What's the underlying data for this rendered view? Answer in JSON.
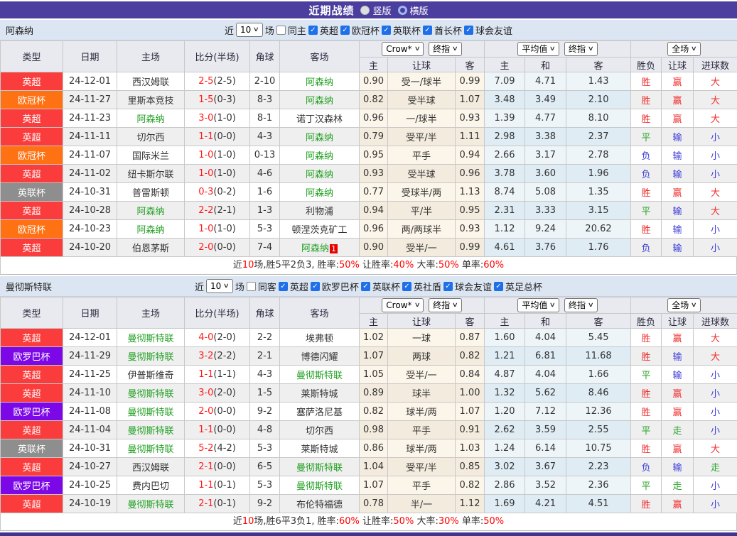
{
  "title_bar": {
    "title": "近期战绩",
    "radios": [
      {
        "label": "竖版",
        "selected": false
      },
      {
        "label": "横版",
        "selected": true
      }
    ]
  },
  "colors": {
    "league": {
      "英超": "#fb3c3c",
      "欧冠杯": "#ff7214",
      "英联杯": "#8e8e8e",
      "欧罗巴杯": "#7c08e8"
    },
    "outcome": {
      "胜": "#f03030",
      "赢": "#f03030",
      "大": "#f03030",
      "平": "#2ca52c",
      "走": "#2ca52c",
      "负": "#3b3bd8",
      "输": "#3b3bd8",
      "小": "#3b3bd8"
    },
    "focus_team": "#22a022",
    "score": "#ff1a1a",
    "half_score": "#333333"
  },
  "sections": [
    {
      "team": "阿森纳",
      "filter": {
        "near_label": "近",
        "matches": "10",
        "matches_suffix": "场",
        "same_label": "同主",
        "same_checked": false,
        "leagues": [
          {
            "label": "英超",
            "checked": true
          },
          {
            "label": "欧冠杯",
            "checked": true
          },
          {
            "label": "英联杯",
            "checked": true
          },
          {
            "label": "酋长杯",
            "checked": true
          },
          {
            "label": "球会友谊",
            "checked": true
          }
        ]
      },
      "header": {
        "columns": [
          "类型",
          "日期",
          "主场",
          "比分(半场)",
          "角球",
          "客场"
        ],
        "dropdowns": {
          "handicap": [
            "Crow*",
            "终指"
          ],
          "average": [
            "平均值",
            "终指"
          ],
          "result": [
            "全场"
          ]
        },
        "sub": [
          "主",
          "让球",
          "客",
          "主",
          "和",
          "客",
          "胜负",
          "让球",
          "进球数"
        ]
      },
      "rows": [
        {
          "league": "英超",
          "date": "24-12-01",
          "home": "西汉姆联",
          "homeFocus": false,
          "score": "2-5",
          "half": "(2-5)",
          "corner": "2-10",
          "away": "阿森纳",
          "awayFocus": true,
          "note": "",
          "oh": "0.90",
          "line": "受一/球半",
          "oa": "0.99",
          "ah": "7.09",
          "ad": "4.71",
          "aa": "1.43",
          "r1": "胜",
          "r2": "赢",
          "r3": "大"
        },
        {
          "league": "欧冠杯",
          "date": "24-11-27",
          "home": "里斯本竞技",
          "homeFocus": false,
          "score": "1-5",
          "half": "(0-3)",
          "corner": "8-3",
          "away": "阿森纳",
          "awayFocus": true,
          "note": "",
          "oh": "0.82",
          "line": "受半球",
          "oa": "1.07",
          "ah": "3.48",
          "ad": "3.49",
          "aa": "2.10",
          "r1": "胜",
          "r2": "赢",
          "r3": "大"
        },
        {
          "league": "英超",
          "date": "24-11-23",
          "home": "阿森纳",
          "homeFocus": true,
          "score": "3-0",
          "half": "(1-0)",
          "corner": "8-1",
          "away": "诺丁汉森林",
          "awayFocus": false,
          "note": "",
          "oh": "0.96",
          "line": "一/球半",
          "oa": "0.93",
          "ah": "1.39",
          "ad": "4.77",
          "aa": "8.10",
          "r1": "胜",
          "r2": "赢",
          "r3": "大"
        },
        {
          "league": "英超",
          "date": "24-11-11",
          "home": "切尔西",
          "homeFocus": false,
          "score": "1-1",
          "half": "(0-0)",
          "corner": "4-3",
          "away": "阿森纳",
          "awayFocus": true,
          "note": "",
          "oh": "0.79",
          "line": "受平/半",
          "oa": "1.11",
          "ah": "2.98",
          "ad": "3.38",
          "aa": "2.37",
          "r1": "平",
          "r2": "输",
          "r3": "小"
        },
        {
          "league": "欧冠杯",
          "date": "24-11-07",
          "home": "国际米兰",
          "homeFocus": false,
          "score": "1-0",
          "half": "(1-0)",
          "corner": "0-13",
          "away": "阿森纳",
          "awayFocus": true,
          "note": "",
          "oh": "0.95",
          "line": "平手",
          "oa": "0.94",
          "ah": "2.66",
          "ad": "3.17",
          "aa": "2.78",
          "r1": "负",
          "r2": "输",
          "r3": "小"
        },
        {
          "league": "英超",
          "date": "24-11-02",
          "home": "纽卡斯尔联",
          "homeFocus": false,
          "score": "1-0",
          "half": "(1-0)",
          "corner": "4-6",
          "away": "阿森纳",
          "awayFocus": true,
          "note": "",
          "oh": "0.93",
          "line": "受半球",
          "oa": "0.96",
          "ah": "3.78",
          "ad": "3.60",
          "aa": "1.96",
          "r1": "负",
          "r2": "输",
          "r3": "小"
        },
        {
          "league": "英联杯",
          "date": "24-10-31",
          "home": "普雷斯顿",
          "homeFocus": false,
          "score": "0-3",
          "half": "(0-2)",
          "corner": "1-6",
          "away": "阿森纳",
          "awayFocus": true,
          "note": "",
          "oh": "0.77",
          "line": "受球半/两",
          "oa": "1.13",
          "ah": "8.74",
          "ad": "5.08",
          "aa": "1.35",
          "r1": "胜",
          "r2": "赢",
          "r3": "大"
        },
        {
          "league": "英超",
          "date": "24-10-28",
          "home": "阿森纳",
          "homeFocus": true,
          "score": "2-2",
          "half": "(2-1)",
          "corner": "1-3",
          "away": "利物浦",
          "awayFocus": false,
          "note": "",
          "oh": "0.94",
          "line": "平/半",
          "oa": "0.95",
          "ah": "2.31",
          "ad": "3.33",
          "aa": "3.15",
          "r1": "平",
          "r2": "输",
          "r3": "大"
        },
        {
          "league": "欧冠杯",
          "date": "24-10-23",
          "home": "阿森纳",
          "homeFocus": true,
          "score": "1-0",
          "half": "(1-0)",
          "corner": "5-3",
          "away": "顿涅茨克矿工",
          "awayFocus": false,
          "note": "",
          "oh": "0.96",
          "line": "两/两球半",
          "oa": "0.93",
          "ah": "1.12",
          "ad": "9.24",
          "aa": "20.62",
          "r1": "胜",
          "r2": "输",
          "r3": "小"
        },
        {
          "league": "英超",
          "date": "24-10-20",
          "home": "伯恩茅斯",
          "homeFocus": false,
          "score": "2-0",
          "half": "(0-0)",
          "corner": "7-4",
          "away": "阿森纳",
          "awayFocus": true,
          "note": "1",
          "oh": "0.90",
          "line": "受半/一",
          "oa": "0.99",
          "ah": "4.61",
          "ad": "3.76",
          "aa": "1.76",
          "r1": "负",
          "r2": "输",
          "r3": "小"
        }
      ],
      "summary": [
        {
          "t": "近",
          "c": "d"
        },
        {
          "t": "10",
          "c": "r"
        },
        {
          "t": "场,胜5平2负3, 胜率:",
          "c": "d"
        },
        {
          "t": "50%",
          "c": "r"
        },
        {
          "t": " 让胜率:",
          "c": "d"
        },
        {
          "t": "40%",
          "c": "r"
        },
        {
          "t": " 大率:",
          "c": "d"
        },
        {
          "t": "50%",
          "c": "r"
        },
        {
          "t": " 单率:",
          "c": "d"
        },
        {
          "t": "60%",
          "c": "r"
        }
      ]
    },
    {
      "team": "曼彻斯特联",
      "filter": {
        "near_label": "近",
        "matches": "10",
        "matches_suffix": "场",
        "same_label": "同客",
        "same_checked": false,
        "leagues": [
          {
            "label": "英超",
            "checked": true
          },
          {
            "label": "欧罗巴杯",
            "checked": true
          },
          {
            "label": "英联杯",
            "checked": true
          },
          {
            "label": "英社盾",
            "checked": true
          },
          {
            "label": "球会友谊",
            "checked": true
          },
          {
            "label": "英足总杯",
            "checked": true
          }
        ]
      },
      "header": {
        "columns": [
          "类型",
          "日期",
          "主场",
          "比分(半场)",
          "角球",
          "客场"
        ],
        "dropdowns": {
          "handicap": [
            "Crow*",
            "终指"
          ],
          "average": [
            "平均值",
            "终指"
          ],
          "result": [
            "全场"
          ]
        },
        "sub": [
          "主",
          "让球",
          "客",
          "主",
          "和",
          "客",
          "胜负",
          "让球",
          "进球数"
        ]
      },
      "rows": [
        {
          "league": "英超",
          "date": "24-12-01",
          "home": "曼彻斯特联",
          "homeFocus": true,
          "score": "4-0",
          "half": "(2-0)",
          "corner": "2-2",
          "away": "埃弗顿",
          "awayFocus": false,
          "note": "",
          "oh": "1.02",
          "line": "一球",
          "oa": "0.87",
          "ah": "1.60",
          "ad": "4.04",
          "aa": "5.45",
          "r1": "胜",
          "r2": "赢",
          "r3": "大"
        },
        {
          "league": "欧罗巴杯",
          "date": "24-11-29",
          "home": "曼彻斯特联",
          "homeFocus": true,
          "score": "3-2",
          "half": "(2-2)",
          "corner": "2-1",
          "away": "博德闪耀",
          "awayFocus": false,
          "note": "",
          "oh": "1.07",
          "line": "两球",
          "oa": "0.82",
          "ah": "1.21",
          "ad": "6.81",
          "aa": "11.68",
          "r1": "胜",
          "r2": "输",
          "r3": "大"
        },
        {
          "league": "英超",
          "date": "24-11-25",
          "home": "伊普斯维奇",
          "homeFocus": false,
          "score": "1-1",
          "half": "(1-1)",
          "corner": "4-3",
          "away": "曼彻斯特联",
          "awayFocus": true,
          "note": "",
          "oh": "1.05",
          "line": "受半/一",
          "oa": "0.84",
          "ah": "4.87",
          "ad": "4.04",
          "aa": "1.66",
          "r1": "平",
          "r2": "输",
          "r3": "小"
        },
        {
          "league": "英超",
          "date": "24-11-10",
          "home": "曼彻斯特联",
          "homeFocus": true,
          "score": "3-0",
          "half": "(2-0)",
          "corner": "1-5",
          "away": "莱斯特城",
          "awayFocus": false,
          "note": "",
          "oh": "0.89",
          "line": "球半",
          "oa": "1.00",
          "ah": "1.32",
          "ad": "5.62",
          "aa": "8.46",
          "r1": "胜",
          "r2": "赢",
          "r3": "小"
        },
        {
          "league": "欧罗巴杯",
          "date": "24-11-08",
          "home": "曼彻斯特联",
          "homeFocus": true,
          "score": "2-0",
          "half": "(0-0)",
          "corner": "9-2",
          "away": "塞萨洛尼基",
          "awayFocus": false,
          "note": "",
          "oh": "0.82",
          "line": "球半/两",
          "oa": "1.07",
          "ah": "1.20",
          "ad": "7.12",
          "aa": "12.36",
          "r1": "胜",
          "r2": "赢",
          "r3": "小"
        },
        {
          "league": "英超",
          "date": "24-11-04",
          "home": "曼彻斯特联",
          "homeFocus": true,
          "score": "1-1",
          "half": "(0-0)",
          "corner": "4-8",
          "away": "切尔西",
          "awayFocus": false,
          "note": "",
          "oh": "0.98",
          "line": "平手",
          "oa": "0.91",
          "ah": "2.62",
          "ad": "3.59",
          "aa": "2.55",
          "r1": "平",
          "r2": "走",
          "r3": "小"
        },
        {
          "league": "英联杯",
          "date": "24-10-31",
          "home": "曼彻斯特联",
          "homeFocus": true,
          "score": "5-2",
          "half": "(4-2)",
          "corner": "5-3",
          "away": "莱斯特城",
          "awayFocus": false,
          "note": "",
          "oh": "0.86",
          "line": "球半/两",
          "oa": "1.03",
          "ah": "1.24",
          "ad": "6.14",
          "aa": "10.75",
          "r1": "胜",
          "r2": "赢",
          "r3": "大"
        },
        {
          "league": "英超",
          "date": "24-10-27",
          "home": "西汉姆联",
          "homeFocus": false,
          "score": "2-1",
          "half": "(0-0)",
          "corner": "6-5",
          "away": "曼彻斯特联",
          "awayFocus": true,
          "note": "",
          "oh": "1.04",
          "line": "受平/半",
          "oa": "0.85",
          "ah": "3.02",
          "ad": "3.67",
          "aa": "2.23",
          "r1": "负",
          "r2": "输",
          "r3": "走"
        },
        {
          "league": "欧罗巴杯",
          "date": "24-10-25",
          "home": "费内巴切",
          "homeFocus": false,
          "score": "1-1",
          "half": "(0-1)",
          "corner": "5-3",
          "away": "曼彻斯特联",
          "awayFocus": true,
          "note": "",
          "oh": "1.07",
          "line": "平手",
          "oa": "0.82",
          "ah": "2.86",
          "ad": "3.52",
          "aa": "2.36",
          "r1": "平",
          "r2": "走",
          "r3": "小"
        },
        {
          "league": "英超",
          "date": "24-10-19",
          "home": "曼彻斯特联",
          "homeFocus": true,
          "score": "2-1",
          "half": "(0-1)",
          "corner": "9-2",
          "away": "布伦特福德",
          "awayFocus": false,
          "note": "",
          "oh": "0.78",
          "line": "半/一",
          "oa": "1.12",
          "ah": "1.69",
          "ad": "4.21",
          "aa": "4.51",
          "r1": "胜",
          "r2": "赢",
          "r3": "小"
        }
      ],
      "summary": [
        {
          "t": "近",
          "c": "d"
        },
        {
          "t": "10",
          "c": "r"
        },
        {
          "t": "场,胜6平3负1, 胜率:",
          "c": "d"
        },
        {
          "t": "60%",
          "c": "r"
        },
        {
          "t": " 让胜率:",
          "c": "d"
        },
        {
          "t": "50%",
          "c": "r"
        },
        {
          "t": " 大率:",
          "c": "d"
        },
        {
          "t": "30%",
          "c": "r"
        },
        {
          "t": " 单率:",
          "c": "d"
        },
        {
          "t": "50%",
          "c": "r"
        }
      ]
    }
  ]
}
